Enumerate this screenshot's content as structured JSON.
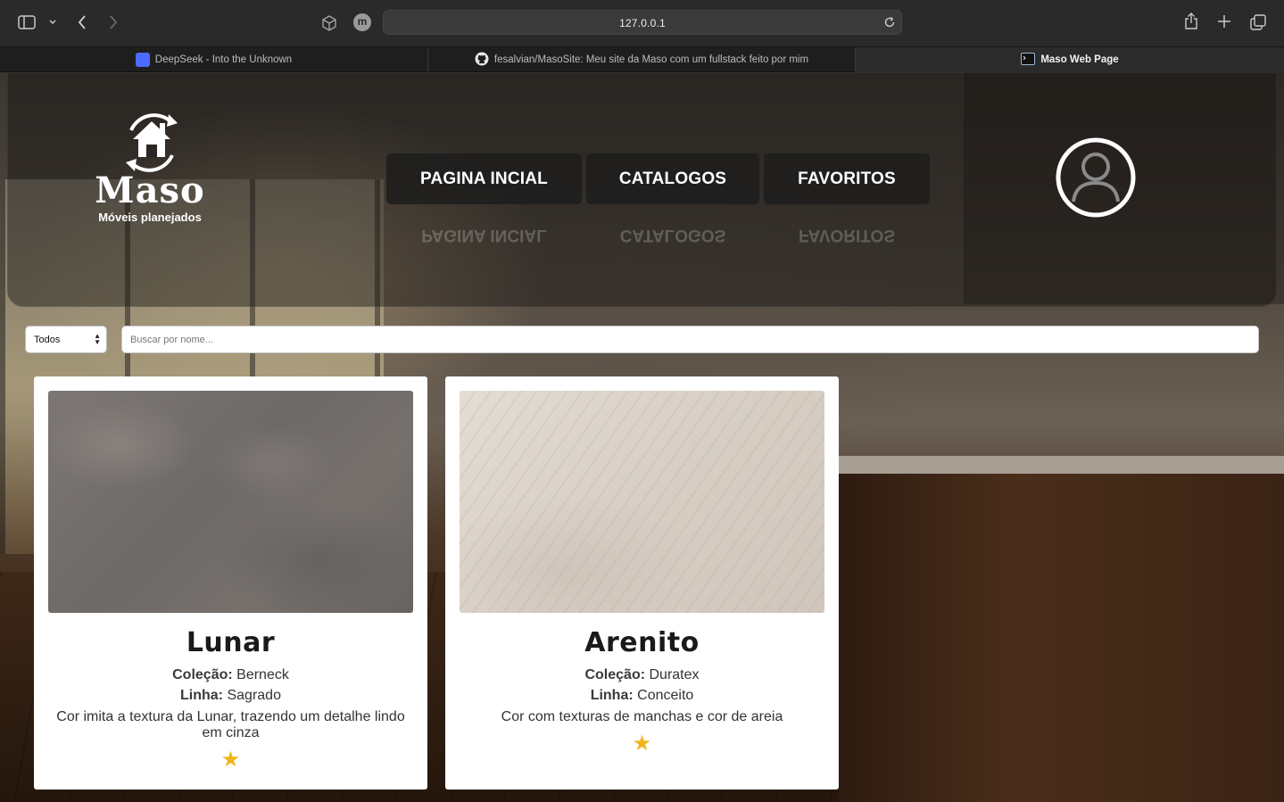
{
  "browser": {
    "url": "127.0.0.1",
    "profile_initial": "m",
    "tabs": [
      {
        "label": "DeepSeek - Into the Unknown",
        "active": false
      },
      {
        "label": "fesalvian/MasoSite: Meu site da Maso com um fullstack feito por mim",
        "active": false
      },
      {
        "label": "Maso Web Page",
        "active": true
      }
    ]
  },
  "header": {
    "logo_text": "Maso",
    "logo_subtitle": "Móveis planejados",
    "nav": [
      {
        "label": "PAGINA INCIAL"
      },
      {
        "label": "CATALOGOS"
      },
      {
        "label": "FAVORITOS"
      }
    ]
  },
  "filters": {
    "category_selected": "Todos",
    "search_placeholder": "Buscar por nome..."
  },
  "products": [
    {
      "name": "Lunar",
      "collection_label": "Coleção:",
      "collection": "Berneck",
      "line_label": "Linha:",
      "line": "Sagrado",
      "description": "Cor imita a textura da Lunar, trazendo um detalhe lindo em cinza",
      "favorite_icon": "star-icon"
    },
    {
      "name": "Arenito",
      "collection_label": "Coleção:",
      "collection": "Duratex",
      "line_label": "Linha:",
      "line": "Conceito",
      "description": "Cor com texturas de manchas e cor de areia",
      "favorite_icon": "star-icon"
    }
  ],
  "colors": {
    "star": "#f0b419",
    "nav_bg": "#1e1e1e",
    "card_bg": "#ffffff"
  }
}
